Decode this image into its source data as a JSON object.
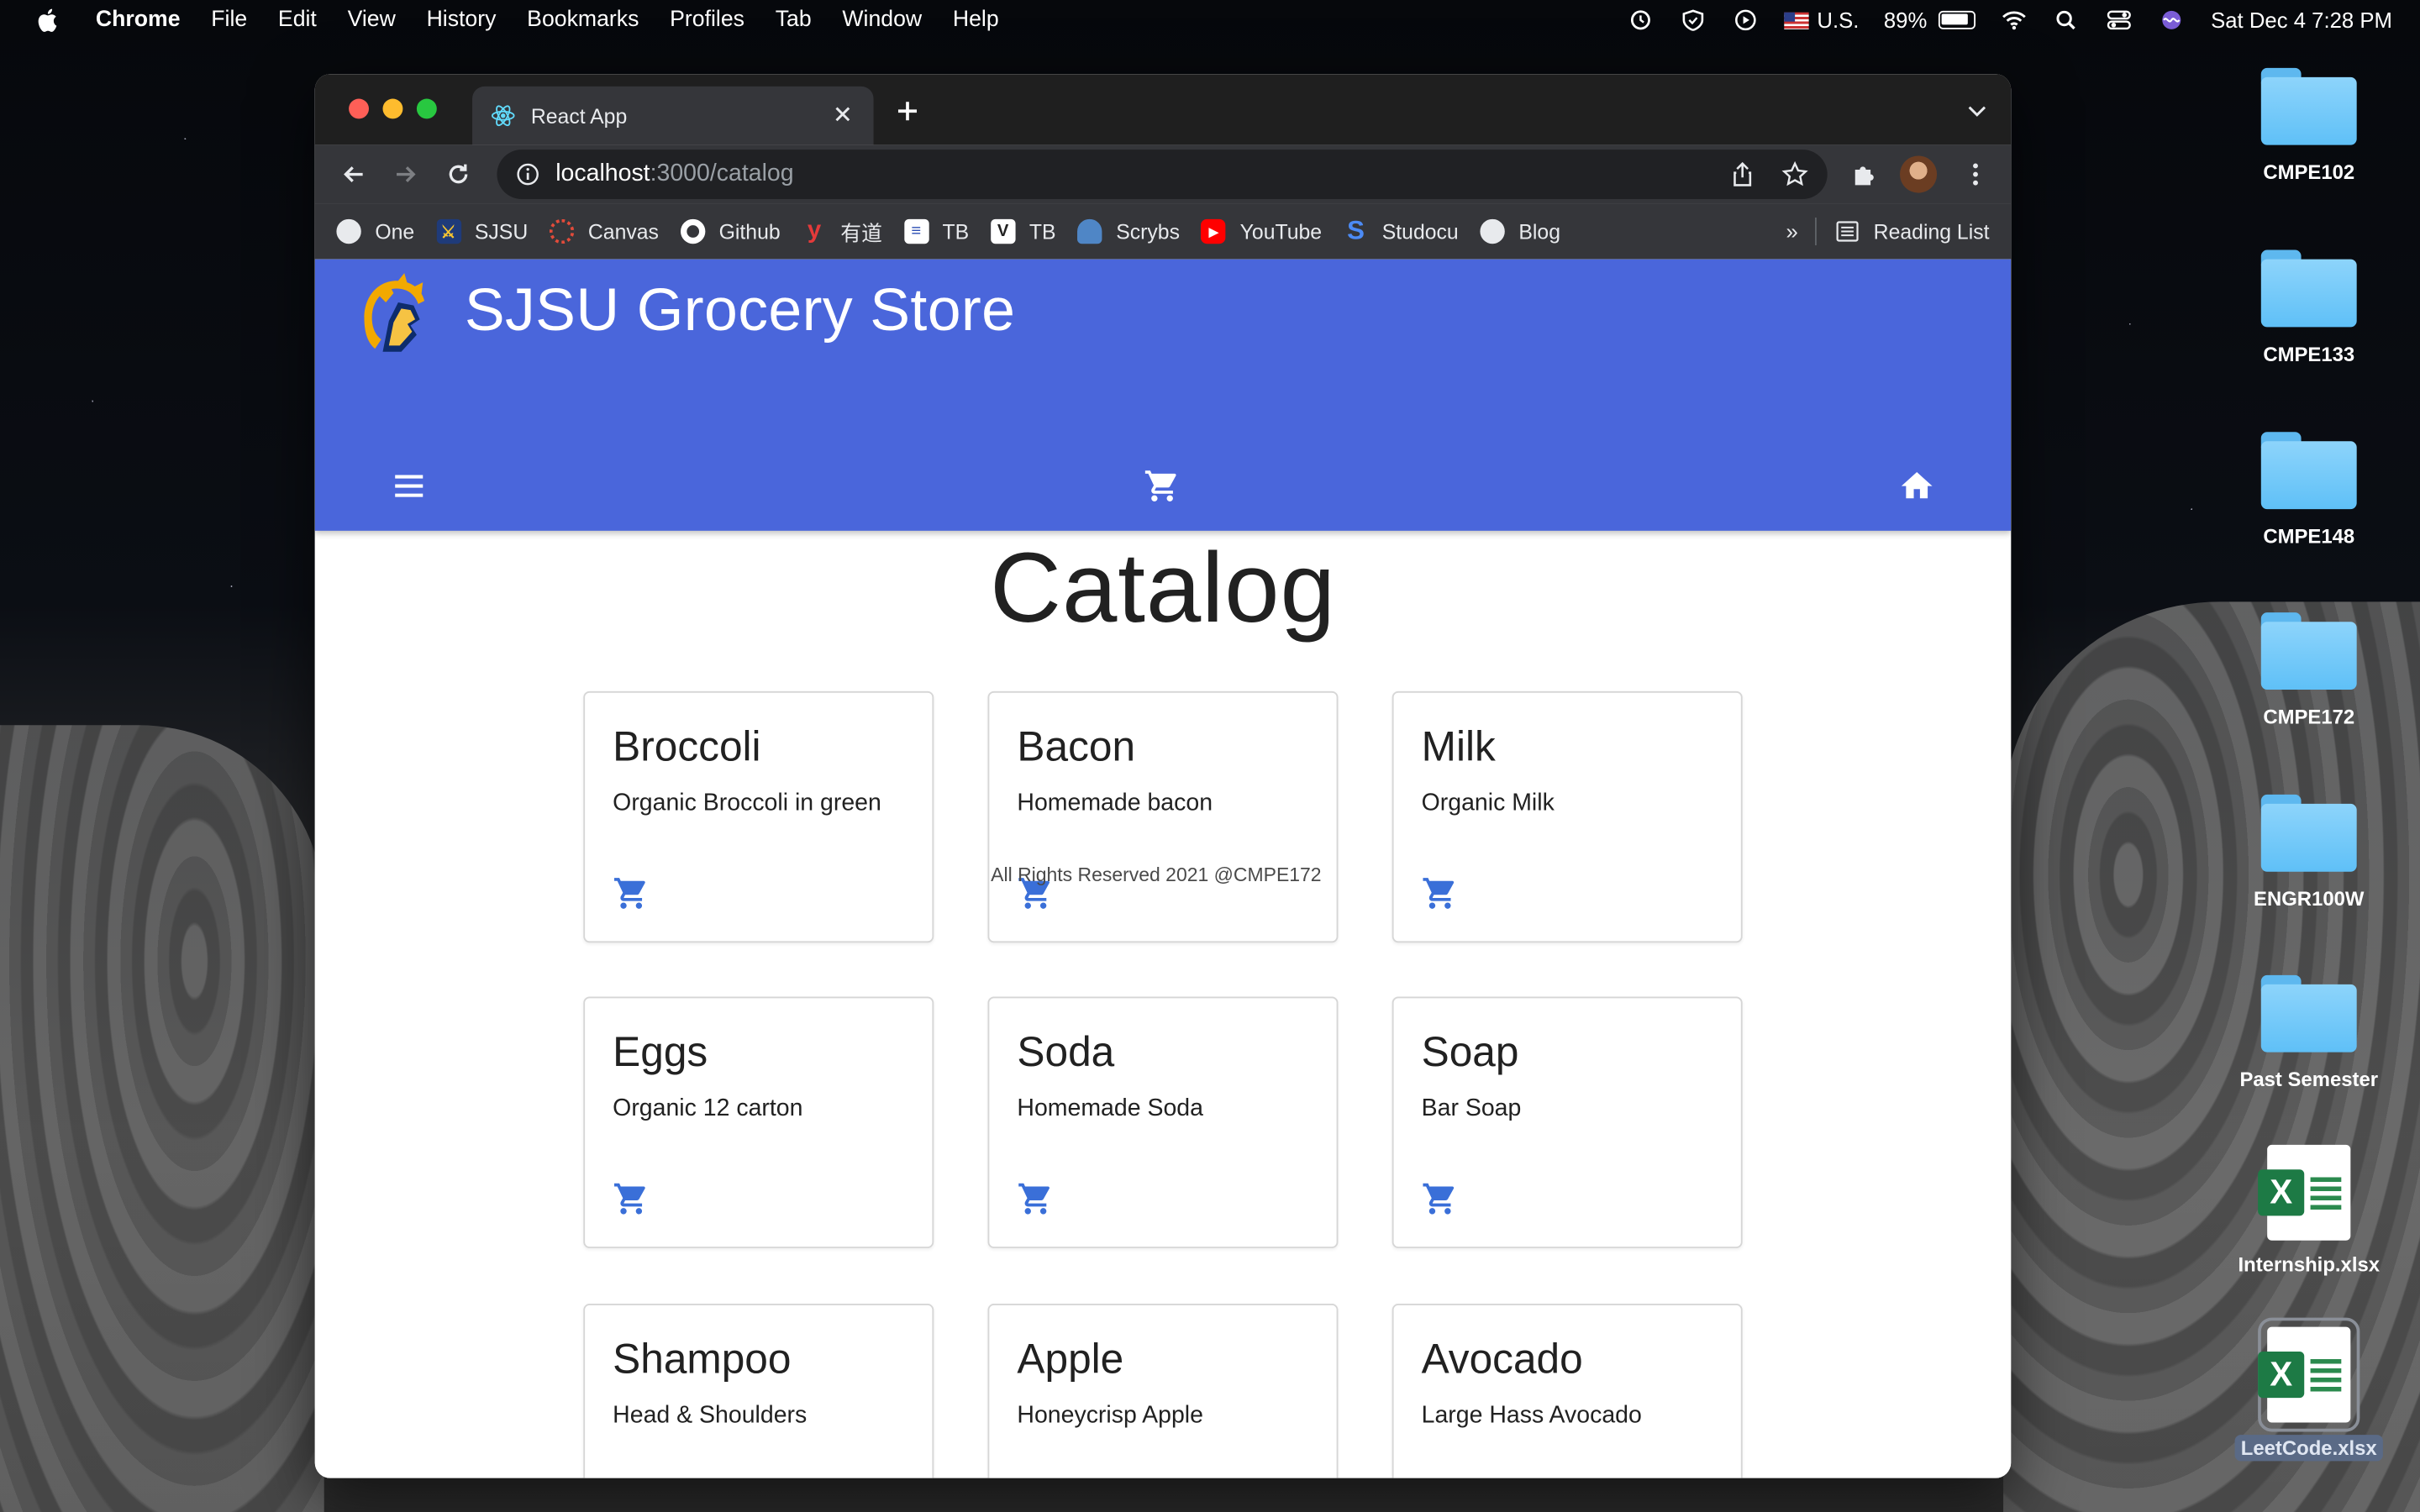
{
  "menubar": {
    "app": "Chrome",
    "items": [
      "File",
      "Edit",
      "View",
      "History",
      "Bookmarks",
      "Profiles",
      "Tab",
      "Window",
      "Help"
    ],
    "input_source": "U.S.",
    "battery": "89%",
    "datetime": "Sat Dec 4  7:28 PM"
  },
  "desktop": {
    "items": [
      {
        "label": "CMPE102",
        "type": "folder"
      },
      {
        "label": "CMPE133",
        "type": "folder"
      },
      {
        "label": "CMPE148",
        "type": "folder"
      },
      {
        "label": "CMPE172",
        "type": "folder"
      },
      {
        "label": "ENGR100W",
        "type": "folder"
      },
      {
        "label": "Past Semester",
        "type": "folder"
      },
      {
        "label": "Internship.xlsx",
        "type": "xlsx"
      },
      {
        "label": "LeetCode.xlsx",
        "type": "xlsx"
      }
    ]
  },
  "browser": {
    "tab_title": "React App",
    "url_host": "localhost",
    "url_path": ":3000/catalog",
    "bookmarks": [
      "One",
      "SJSU",
      "Canvas",
      "Github",
      "有道",
      "TB",
      "TB",
      "Scrybs",
      "YouTube",
      "Studocu",
      "Blog"
    ],
    "bookmarks_more": "»",
    "reading_list": "Reading List"
  },
  "page": {
    "app_title": "SJSU Grocery Store",
    "heading": "Catalog",
    "footer": "All Rights Reserved 2021 @CMPE172",
    "accent_color": "#4a66db",
    "cart_icon_color": "#3a6fd8",
    "products": [
      {
        "name": "Broccoli",
        "description": "Organic Broccoli in green"
      },
      {
        "name": "Bacon",
        "description": "Homemade bacon"
      },
      {
        "name": "Milk",
        "description": "Organic Milk"
      },
      {
        "name": "Eggs",
        "description": "Organic 12 carton"
      },
      {
        "name": "Soda",
        "description": "Homemade Soda"
      },
      {
        "name": "Soap",
        "description": "Bar Soap"
      },
      {
        "name": "Shampoo",
        "description": "Head & Shoulders"
      },
      {
        "name": "Apple",
        "description": "Honeycrisp Apple"
      },
      {
        "name": "Avocado",
        "description": "Large Hass Avocado"
      }
    ]
  }
}
